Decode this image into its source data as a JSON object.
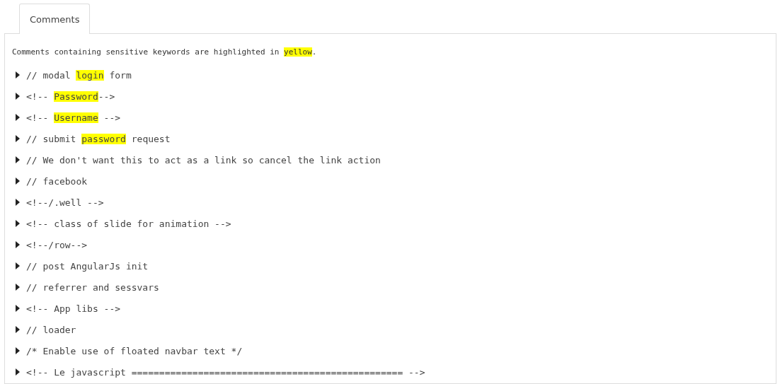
{
  "tabs": [
    {
      "label": "Comments",
      "selected": true
    }
  ],
  "intro": [
    {
      "text": "Comments containing sensitive keywords are highlighted in ",
      "highlight": false
    },
    {
      "text": "yellow",
      "highlight": true
    },
    {
      "text": ".",
      "highlight": false
    }
  ],
  "comments": [
    {
      "expanded": false,
      "parts": [
        {
          "text": "// modal ",
          "highlight": false
        },
        {
          "text": "login",
          "highlight": true
        },
        {
          "text": " form",
          "highlight": false
        }
      ]
    },
    {
      "expanded": false,
      "parts": [
        {
          "text": "<!-- ",
          "highlight": false
        },
        {
          "text": "Password",
          "highlight": true
        },
        {
          "text": "-->",
          "highlight": false
        }
      ]
    },
    {
      "expanded": false,
      "parts": [
        {
          "text": "<!-- ",
          "highlight": false
        },
        {
          "text": "Username",
          "highlight": true
        },
        {
          "text": " -->",
          "highlight": false
        }
      ]
    },
    {
      "expanded": false,
      "parts": [
        {
          "text": "// submit ",
          "highlight": false
        },
        {
          "text": "password",
          "highlight": true
        },
        {
          "text": " request",
          "highlight": false
        }
      ]
    },
    {
      "expanded": false,
      "parts": [
        {
          "text": "// We don't want this to act as a link so cancel the link action",
          "highlight": false
        }
      ]
    },
    {
      "expanded": false,
      "parts": [
        {
          "text": "// facebook",
          "highlight": false
        }
      ]
    },
    {
      "expanded": false,
      "parts": [
        {
          "text": "<!--/.well -->",
          "highlight": false
        }
      ]
    },
    {
      "expanded": false,
      "parts": [
        {
          "text": "<!-- class of slide for animation -->",
          "highlight": false
        }
      ]
    },
    {
      "expanded": false,
      "parts": [
        {
          "text": "<!--/row-->",
          "highlight": false
        }
      ]
    },
    {
      "expanded": false,
      "parts": [
        {
          "text": "// post AngularJs init",
          "highlight": false
        }
      ]
    },
    {
      "expanded": false,
      "parts": [
        {
          "text": "// referrer and sessvars",
          "highlight": false
        }
      ]
    },
    {
      "expanded": false,
      "parts": [
        {
          "text": "<!-- App libs -->",
          "highlight": false
        }
      ]
    },
    {
      "expanded": false,
      "parts": [
        {
          "text": "// loader",
          "highlight": false
        }
      ]
    },
    {
      "expanded": false,
      "parts": [
        {
          "text": "/* Enable use of floated navbar text */",
          "highlight": false
        }
      ]
    },
    {
      "expanded": false,
      "parts": [
        {
          "text": "<!-- Le javascript ================================================= -->",
          "highlight": false
        }
      ]
    }
  ]
}
